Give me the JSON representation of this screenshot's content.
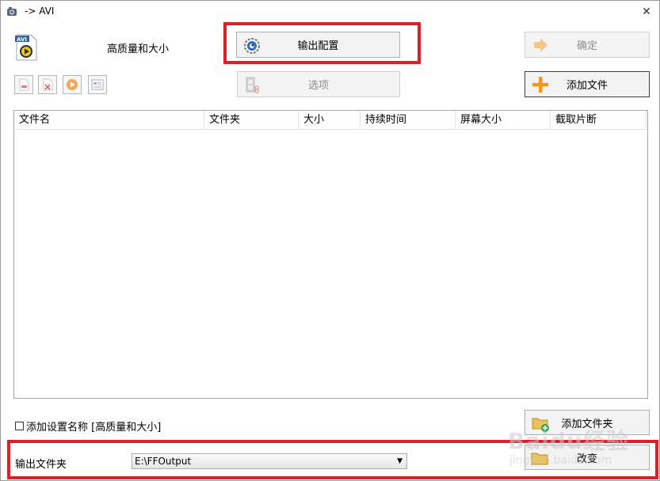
{
  "window": {
    "title": "-> AVI",
    "close_glyph": "✕"
  },
  "profile": {
    "label": "高质量和大小",
    "icon": "avi-file-icon"
  },
  "buttons": {
    "output_config": "输出配置",
    "ok": "确定",
    "options": "选项",
    "add_file": "添加文件",
    "add_folder": "添加文件夹",
    "change": "改变"
  },
  "toolbar": {
    "items": [
      {
        "name": "remove-file-icon"
      },
      {
        "name": "clear-list-icon"
      },
      {
        "name": "play-icon"
      },
      {
        "name": "media-info-icon"
      }
    ]
  },
  "table": {
    "columns": [
      "文件名",
      "文件夹",
      "大小",
      "持续时间",
      "屏幕大小",
      "截取片断"
    ],
    "rows": []
  },
  "options": {
    "append_setting_name": "添加设置名称 [高质量和大小]",
    "append_setting_checked": false
  },
  "output": {
    "label": "输出文件夹",
    "folder": "E:\\FFOutput"
  },
  "watermark": {
    "main": "Baidu经验",
    "sub": "jingyan.baidu.com"
  },
  "colors": {
    "highlight": "#e21d2b",
    "accent_orange": "#f39a1e"
  }
}
